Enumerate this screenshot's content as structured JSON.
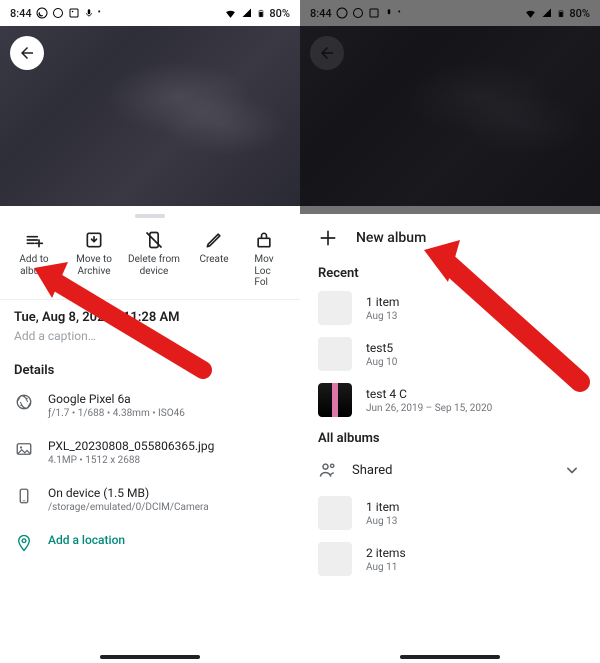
{
  "statusbar": {
    "time": "8:44",
    "battery_pct": "80%"
  },
  "left": {
    "actions": {
      "add_to_album": "Add to album",
      "move_to_archive": "Move to Archive",
      "delete_from_device": "Delete from device",
      "create": "Create",
      "move_to_locked": "Move to Locked Folder"
    },
    "timestamp": "Tue, Aug 8, 2023 • 11:28 AM",
    "caption_hint": "Add a caption…",
    "details_hdr": "Details",
    "device": {
      "name": "Google Pixel 6a",
      "meta": "ƒ/1.7  •  1/688  •  4.38mm  •  ISO46"
    },
    "file": {
      "name": "PXL_20230808_055806365.jpg",
      "meta": "4.1MP  •  1512 x 2688"
    },
    "storage": {
      "name": "On device (1.5 MB)",
      "meta": "/storage/emulated/0/DCIM/Camera"
    },
    "location_add": "Add a location"
  },
  "right": {
    "new_album": "New album",
    "recent_hdr": "Recent",
    "recent": [
      {
        "title": "1 item",
        "sub": "Aug 13"
      },
      {
        "title": "test5",
        "sub": "Aug 10"
      },
      {
        "title": "test 4 C",
        "sub": "Jun 26, 2019 – Sep 15, 2020"
      }
    ],
    "all_hdr": "All albums",
    "shared": "Shared",
    "all": [
      {
        "title": "1 item",
        "sub": "Aug 13"
      },
      {
        "title": "2 items",
        "sub": "Aug 11"
      }
    ]
  }
}
